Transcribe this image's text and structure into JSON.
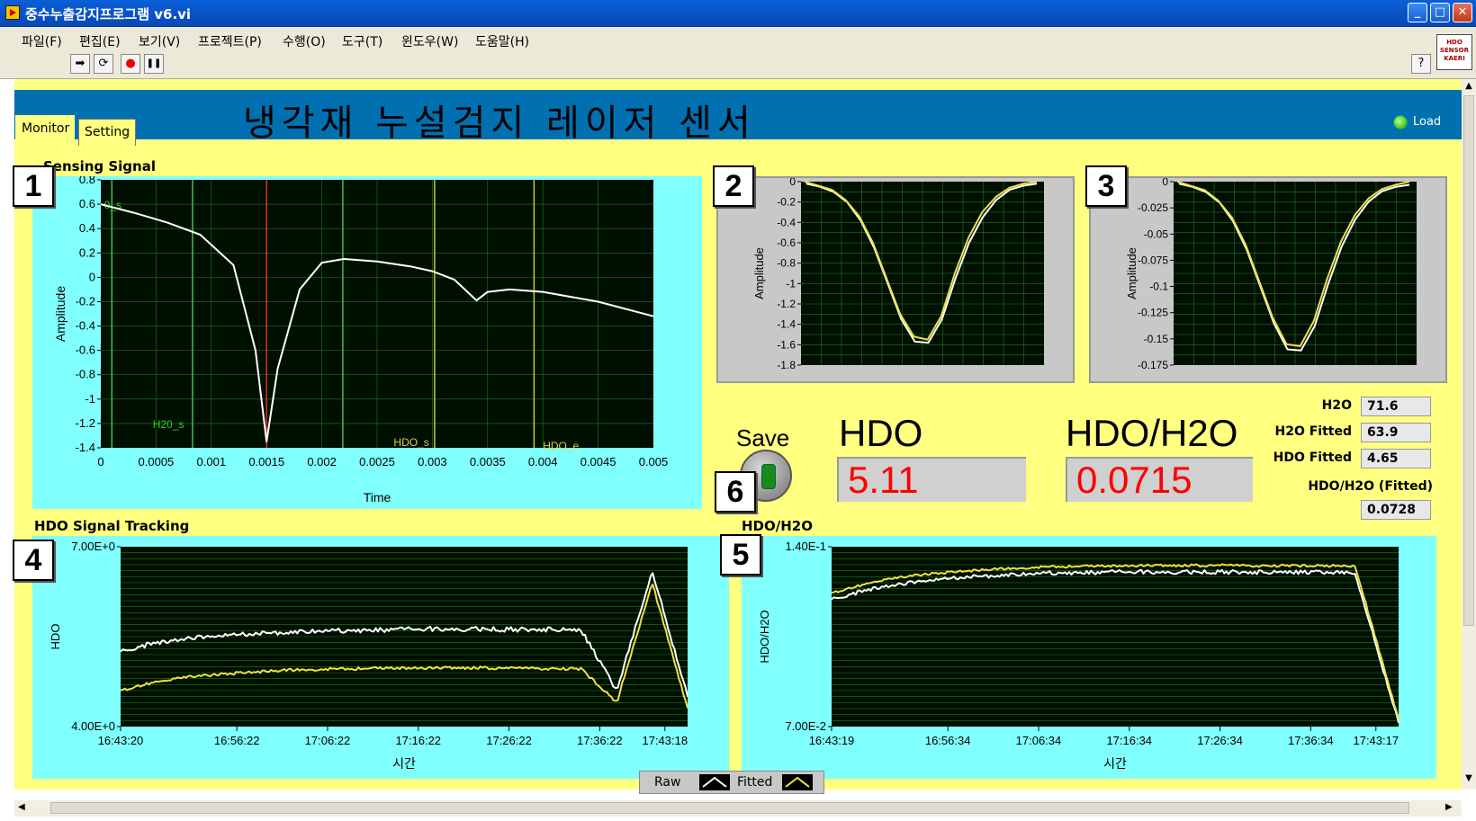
{
  "window": {
    "title": "중수누출감지프로그램 v6.vi",
    "min": "_",
    "max": "□",
    "close": "✕"
  },
  "menu": [
    "파일(F)",
    "편집(E)",
    "보기(V)",
    "프로젝트(P)",
    "수행(O)",
    "도구(T)",
    "윈도우(W)",
    "도움말(H)"
  ],
  "toolbar": {
    "run": "➡",
    "run_cont": "⟳",
    "abort": "●",
    "pause": "❚❚",
    "help": "?"
  },
  "brand": {
    "line1": "HDO",
    "line2": "SENSOR",
    "line3": "KAERI"
  },
  "header": {
    "title": "냉각재 누설검지 레이저 센서",
    "load_label": "Load"
  },
  "tabs": [
    "Monitor",
    "Setting"
  ],
  "markers": [
    "1",
    "2",
    "3",
    "4",
    "5",
    "6"
  ],
  "sensing": {
    "title": "Sensing Signal",
    "xlabel": "Time",
    "ylabel": "Amplitude",
    "cursor_labels": [
      "H20_s",
      "HDO_s",
      "HDO_e",
      "0_s"
    ]
  },
  "fit1": {
    "ylabel": "Amplitude"
  },
  "fit2": {
    "ylabel": "Amplitude"
  },
  "tracking": {
    "title": "HDO Signal Tracking",
    "xlabel": "시간",
    "ylabel": "HDO"
  },
  "ratio": {
    "title": "HDO/H2O",
    "xlabel": "시간",
    "ylabel": "HDO/H2O"
  },
  "readouts": {
    "save_label": "Save",
    "hdo_title": "HDO",
    "hdo_value": "5.11",
    "ratio_title": "HDO/H2O",
    "ratio_value": "0.0715",
    "h2o_label": "H2O",
    "h2o_value": "71.6",
    "h2o_fitted_label": "H2O Fitted",
    "h2o_fitted_value": "63.9",
    "hdo_fitted_label": "HDO Fitted",
    "hdo_fitted_value": "4.65",
    "ratio_fitted_label": "HDO/H2O (Fitted)",
    "ratio_fitted_value": "0.0728"
  },
  "legend": {
    "raw": "Raw",
    "fitted": "Fitted"
  },
  "colors": {
    "panel": "#ffff80",
    "header": "#0070b0",
    "plot_bg": "#001000",
    "grid": "#1f7a1f",
    "trace_raw": "#ffffff",
    "trace_fit": "#f0e040"
  },
  "chart_data": [
    {
      "type": "line",
      "title": "Sensing Signal",
      "xlabel": "Time",
      "ylabel": "Amplitude",
      "xlim": [
        0,
        0.005
      ],
      "ylim": [
        -1.4,
        0.8
      ],
      "x_ticks": [
        "0",
        "0.0005",
        "0.001",
        "0.0015",
        "0.002",
        "0.0025",
        "0.003",
        "0.0035",
        "0.004",
        "0.0045",
        "0.005"
      ],
      "y_ticks": [
        "0.8",
        "0.6",
        "0.4",
        "0.2",
        "0",
        "-0.2",
        "-0.4",
        "-0.6",
        "-0.8",
        "-1",
        "-1.2",
        "-1.4"
      ],
      "cursors": [
        {
          "label": "0_s",
          "x": 0.0001
        },
        {
          "label": "H20_s",
          "x": 0.00083
        },
        {
          "label": "",
          "x": 0.0015
        },
        {
          "label": "",
          "x": 0.00219
        },
        {
          "label": "HDO_s",
          "x": 0.00302
        },
        {
          "label": "HDO_e",
          "x": 0.00392
        }
      ],
      "series": [
        {
          "x": [
            0,
            0.0003,
            0.0006,
            0.0009,
            0.0012,
            0.0014,
            0.0015,
            0.0016,
            0.0018,
            0.002,
            0.0022,
            0.0025,
            0.0028,
            0.003,
            0.0032,
            0.0034,
            0.0035,
            0.0037,
            0.004,
            0.0045,
            0.005
          ],
          "y": [
            0.6,
            0.53,
            0.45,
            0.35,
            0.1,
            -0.6,
            -1.35,
            -0.75,
            -0.1,
            0.12,
            0.15,
            0.13,
            0.09,
            0.05,
            -0.02,
            -0.19,
            -0.12,
            -0.1,
            -0.12,
            -0.2,
            -0.32
          ]
        }
      ]
    },
    {
      "type": "line",
      "ylabel": "Amplitude",
      "ylim": [
        -1.8,
        0
      ],
      "y_ticks": [
        "0",
        "-0.2",
        "-0.4",
        "-0.6",
        "-0.8",
        "-1",
        "-1.2",
        "-1.4",
        "-1.6",
        "-1.8"
      ],
      "series": [
        {
          "y": [
            -0.02,
            -0.05,
            -0.1,
            -0.2,
            -0.38,
            -0.65,
            -1.0,
            -1.35,
            -1.57,
            -1.58,
            -1.35,
            -0.95,
            -0.6,
            -0.35,
            -0.18,
            -0.08,
            -0.04,
            -0.02
          ]
        },
        {
          "y": [
            0,
            -0.04,
            -0.08,
            -0.18,
            -0.34,
            -0.6,
            -0.95,
            -1.3,
            -1.52,
            -1.55,
            -1.32,
            -0.9,
            -0.55,
            -0.3,
            -0.15,
            -0.06,
            -0.02,
            0
          ]
        }
      ]
    },
    {
      "type": "line",
      "ylabel": "Amplitude",
      "ylim": [
        -0.175,
        0
      ],
      "y_ticks": [
        "0",
        "-0.025",
        "-0.05",
        "-0.075",
        "-0.1",
        "-0.125",
        "-0.15",
        "-0.175"
      ],
      "series": [
        {
          "y": [
            -0.002,
            -0.005,
            -0.01,
            -0.02,
            -0.038,
            -0.065,
            -0.1,
            -0.135,
            -0.16,
            -0.161,
            -0.138,
            -0.098,
            -0.062,
            -0.036,
            -0.019,
            -0.009,
            -0.005,
            -0.003
          ]
        },
        {
          "y": [
            0,
            -0.004,
            -0.008,
            -0.018,
            -0.034,
            -0.06,
            -0.095,
            -0.13,
            -0.155,
            -0.157,
            -0.133,
            -0.092,
            -0.057,
            -0.032,
            -0.016,
            -0.007,
            -0.003,
            0
          ]
        }
      ]
    },
    {
      "type": "line",
      "title": "HDO Signal Tracking",
      "xlabel": "시간",
      "ylabel": "HDO",
      "ylim": [
        4.0,
        7.0
      ],
      "y_ticks": [
        "7.00E+0",
        "4.00E+0"
      ],
      "x_ticks": [
        "16:43:20",
        "16:56:22",
        "17:06:22",
        "17:16:22",
        "17:26:22",
        "17:36:22",
        "17:43:18"
      ],
      "series": [
        {
          "name": "Raw",
          "y": [
            5.25,
            5.4,
            5.48,
            5.52,
            5.55,
            5.58,
            5.6,
            5.61,
            5.62,
            5.63,
            5.63,
            5.62,
            5.62,
            5.6,
            4.6,
            6.6,
            4.5
          ]
        },
        {
          "name": "Fitted",
          "y": [
            4.6,
            4.75,
            4.83,
            4.88,
            4.92,
            4.95,
            4.96,
            4.97,
            4.98,
            4.98,
            4.98,
            4.97,
            4.97,
            4.96,
            4.4,
            6.4,
            4.3
          ]
        }
      ]
    },
    {
      "type": "line",
      "title": "HDO/H2O",
      "xlabel": "시간",
      "ylabel": "HDO/H2O",
      "ylim": [
        0.07,
        0.14
      ],
      "y_ticks": [
        "1.40E-1",
        "7.00E-2"
      ],
      "x_ticks": [
        "16:43:19",
        "16:56:34",
        "17:06:34",
        "17:16:34",
        "17:26:34",
        "17:36:34",
        "17:43:17"
      ],
      "series": [
        {
          "name": "Raw",
          "y": [
            0.1195,
            0.124,
            0.1265,
            0.128,
            0.129,
            0.1298,
            0.13,
            0.1302,
            0.1302,
            0.1302,
            0.13,
            0.13,
            0.13,
            0.0715
          ]
        },
        {
          "name": "Fitted",
          "y": [
            0.122,
            0.1265,
            0.129,
            0.1305,
            0.1315,
            0.1322,
            0.1325,
            0.1327,
            0.1327,
            0.1327,
            0.1326,
            0.1326,
            0.1326,
            0.0728
          ]
        }
      ]
    }
  ]
}
